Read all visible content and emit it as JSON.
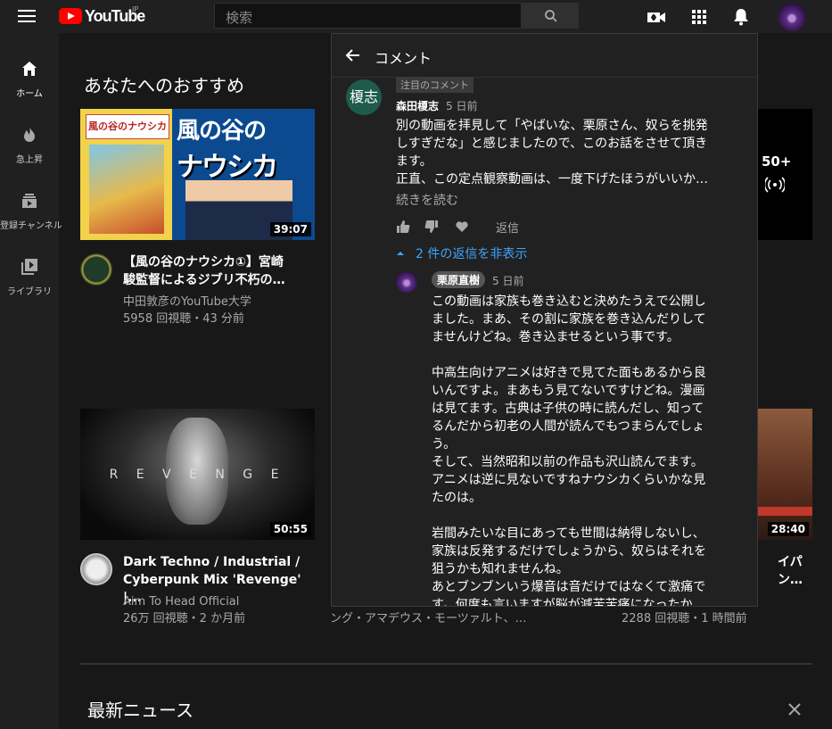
{
  "header": {
    "logo_text": "YouTube",
    "region": "JP",
    "search_placeholder": "検索"
  },
  "sidebar": {
    "items": [
      {
        "label": "ホーム"
      },
      {
        "label": "急上昇"
      },
      {
        "label": "登録チャンネル"
      },
      {
        "label": "ライブラリ"
      }
    ]
  },
  "main": {
    "section_title": "あなたへのおすすめ",
    "videos": [
      {
        "title_line1": "【風の谷のナウシカ①】宮崎",
        "title_line2": "駿監督によるジブリ不朽の…",
        "channel": "中田敦彦のYouTube大学",
        "stats": "5958 回視聴・43 分前",
        "duration": "39:07",
        "thumb_text1": "風の谷の",
        "thumb_text2": "ナウシカ",
        "manga_title": "風の谷のナウシカ"
      },
      {
        "title_line1": "Dark Techno / Industrial /",
        "title_line2": "Cyberpunk Mix 'Revenge' |...",
        "channel": "Aim To Head Official",
        "stats": "26万 回視聴・2 か月前",
        "duration": "50:55",
        "thumb_text": "R E V E N G E"
      },
      {
        "stats": "2288 回視聴・1 時間前",
        "duration": "28:40",
        "title_partial": "イパ",
        "title_partial2": "ン…"
      },
      {
        "partial_meta": "ング・アマデウス・モーツァルト、…"
      }
    ],
    "live_count": "50+",
    "news_title": "最新ニュース"
  },
  "comments_panel": {
    "title": "コメント",
    "pinned_label": "注目のコメント",
    "comment": {
      "avatar_text": "榎志",
      "author": "森田榎志",
      "time": "5 日前",
      "text": "別の動画を拝見して「やばいな、栗原さん、奴らを挑発\nしすぎだな」と感じましたので、このお話をさせて頂き\nます。\n正直、この定点観察動画は、一度下げたほうがいいか…",
      "read_more": "続きを読む",
      "reply_label": "返信",
      "toggle_replies": "2 件の返信を非表示"
    },
    "reply": {
      "author": "栗原直樹",
      "time": "5 日前",
      "text": "この動画は家族も巻き込むと決めたうえで公開し\nました。まあ、その割に家族を巻き込んだりして\nませんけどね。巻き込ませるという事です。\n\n中高生向けアニメは好きで見てた面もあるから良\nいんですよ。まあもう見てないですけどね。漫画\nは見てます。古典は子供の時に読んだし、知って\nるんだから初老の人間が読んでもつまらんでしょ\nう。\nそして、当然昭和以前の作品も沢山読んでます。\nアニメは逆に見ないですねナウシカくらいかな見\nたのは。\n\n岩間みたいな目にあっても世間は納得しないし、\n家族は反発するだけでしょうから、奴らはそれを\n狙うかも知れませんね。\nあとブンブンいう爆音は音だけではなくて激痛で\nす。何度も言いますが脳が減苦苦痛になったか"
    }
  },
  "colors": {
    "accent": "#3ea6ff",
    "brand": "#ff0000",
    "background": "#181818"
  }
}
